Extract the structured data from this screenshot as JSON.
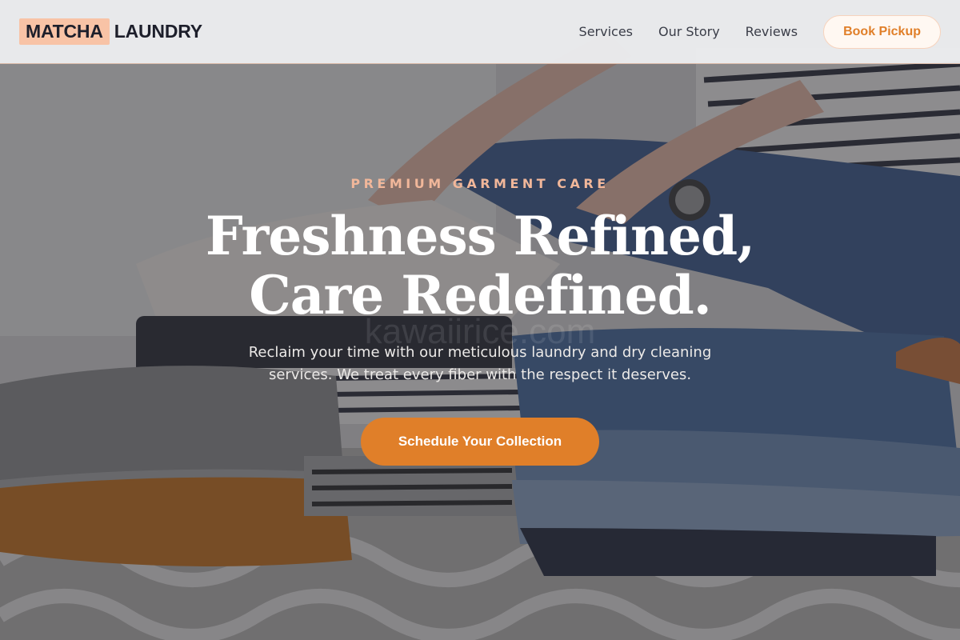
{
  "brand": {
    "logo_mark": "MATCHA",
    "logo_text": "LAUNDRY",
    "accent_color": "#e07f29",
    "logo_highlight_color": "#f8c3a6"
  },
  "nav": {
    "links": [
      "Services",
      "Our Story",
      "Reviews"
    ],
    "cta_label": "Book Pickup"
  },
  "hero": {
    "eyebrow": "PREMIUM GARMENT CARE",
    "headline_line1": "Freshness Refined,",
    "headline_line2": "Care Redefined.",
    "subtext": "Reclaim your time with our meticulous laundry and dry cleaning services. We treat every fiber with the respect it deserves.",
    "cta_label": "Schedule Your Collection",
    "watermark": "kawaiirice.com",
    "background_image": "folded-clothes-photo"
  }
}
